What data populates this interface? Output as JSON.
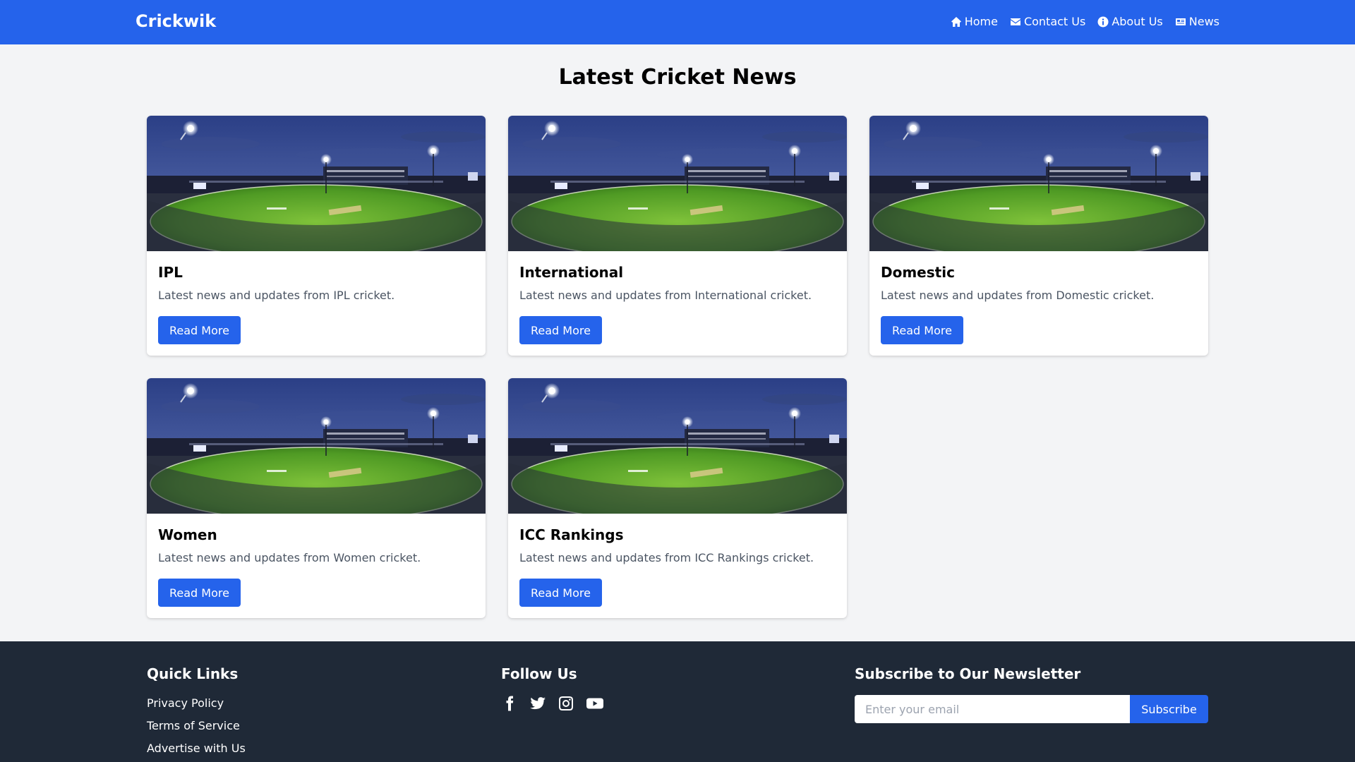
{
  "header": {
    "brand": "Crickwik",
    "nav": [
      {
        "label": "Home",
        "icon": "home-icon"
      },
      {
        "label": "Contact Us",
        "icon": "envelope-icon"
      },
      {
        "label": "About Us",
        "icon": "info-icon"
      },
      {
        "label": "News",
        "icon": "newspaper-icon"
      }
    ]
  },
  "main": {
    "title": "Latest Cricket News",
    "cards": [
      {
        "title": "IPL",
        "description": "Latest news and updates from IPL cricket.",
        "button": "Read More"
      },
      {
        "title": "International",
        "description": "Latest news and updates from International cricket.",
        "button": "Read More"
      },
      {
        "title": "Domestic",
        "description": "Latest news and updates from Domestic cricket.",
        "button": "Read More"
      },
      {
        "title": "Women",
        "description": "Latest news and updates from Women cricket.",
        "button": "Read More"
      },
      {
        "title": "ICC Rankings",
        "description": "Latest news and updates from ICC Rankings cricket.",
        "button": "Read More"
      }
    ]
  },
  "footer": {
    "quick_links": {
      "heading": "Quick Links",
      "items": [
        "Privacy Policy",
        "Terms of Service",
        "Advertise with Us"
      ]
    },
    "follow": {
      "heading": "Follow Us",
      "icons": [
        "facebook-icon",
        "twitter-icon",
        "instagram-icon",
        "youtube-icon"
      ]
    },
    "newsletter": {
      "heading": "Subscribe to Our Newsletter",
      "placeholder": "Enter your email",
      "button": "Subscribe"
    }
  },
  "colors": {
    "primary": "#2563eb",
    "background": "#f3f4f6",
    "footer": "#1f2937"
  }
}
